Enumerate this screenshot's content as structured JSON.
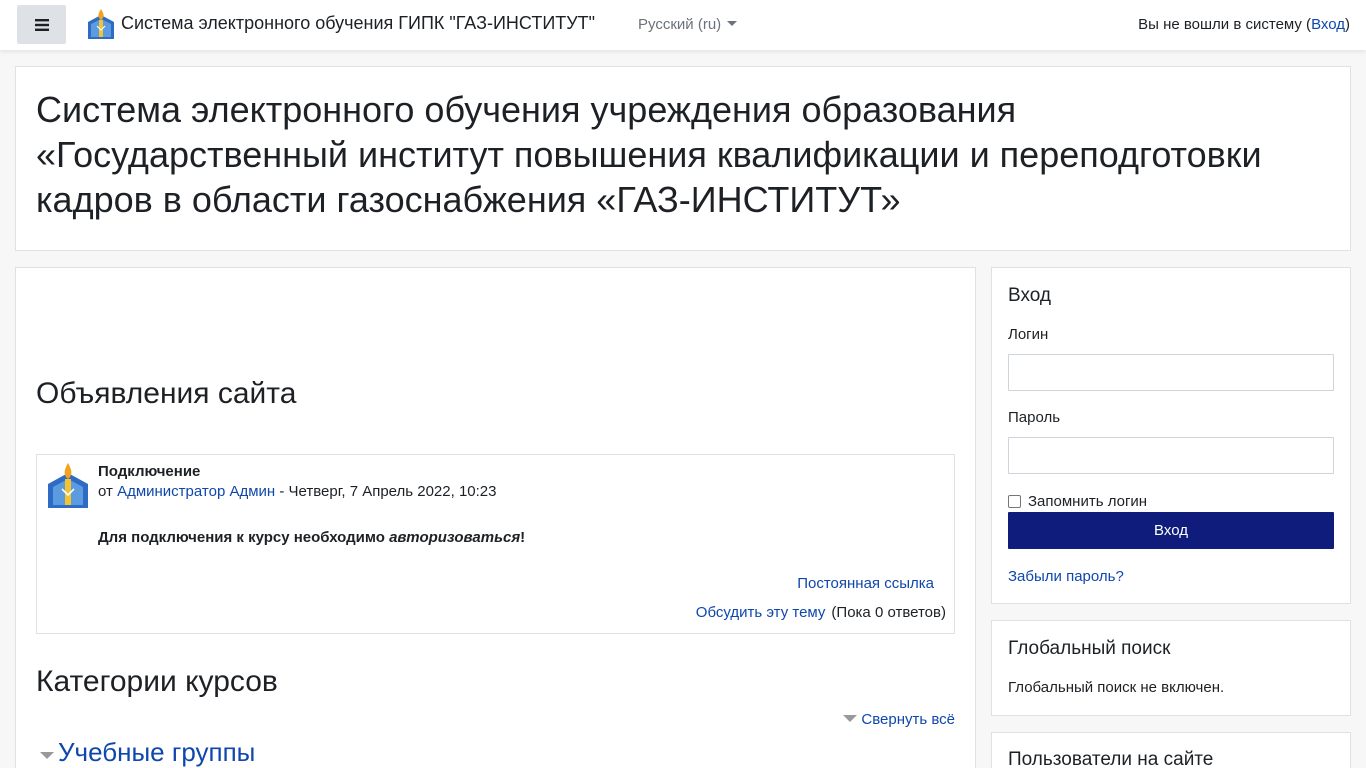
{
  "navbar": {
    "site_name": "Система электронного обучения ГИПК \"ГАЗ-ИНСТИТУТ\"",
    "language": "Русский ‎(ru)‎",
    "login_status_prefix": "Вы не вошли в систему (",
    "login_link": "Вход",
    "login_status_suffix": ")"
  },
  "header": {
    "title": "Система электронного обучения учреждения образования «Государственный институт повышения квалификации и переподготовки кадров в области газоснабжения «ГАЗ-ИНСТИТУТ»"
  },
  "main": {
    "news_title": "Объявления сайта",
    "post": {
      "subject": "Подключение",
      "author_prefix": "от ",
      "author": "Администратор Админ",
      "date": " - Четверг, 7 Апрель 2022, 10:23",
      "body_text": "Для подключения к курсу необходимо ",
      "body_emphasis": "авторизоваться",
      "body_end": "!",
      "permalink": "Постоянная ссылка",
      "discuss": "Обсудить эту тему",
      "replies": "(Пока 0 ответов)"
    },
    "categories_title": "Категории курсов",
    "collapse_all": "Свернуть всё",
    "category": "Учебные группы"
  },
  "login_block": {
    "title": "Вход",
    "username_label": "Логин",
    "password_label": "Пароль",
    "remember_label": "Запомнить логин",
    "submit_label": "Вход",
    "forgot_link": "Забыли пароль?"
  },
  "search_block": {
    "title": "Глобальный поиск",
    "text": "Глобальный поиск не включен."
  },
  "online_block": {
    "title": "Пользователи на сайте"
  },
  "colors": {
    "link": "#0f47ad",
    "button": "#0f1c7c"
  },
  "icons": [
    "menu-icon",
    "site-logo",
    "caret-down-icon",
    "author-avatar",
    "collapse-triangle-icon"
  ]
}
